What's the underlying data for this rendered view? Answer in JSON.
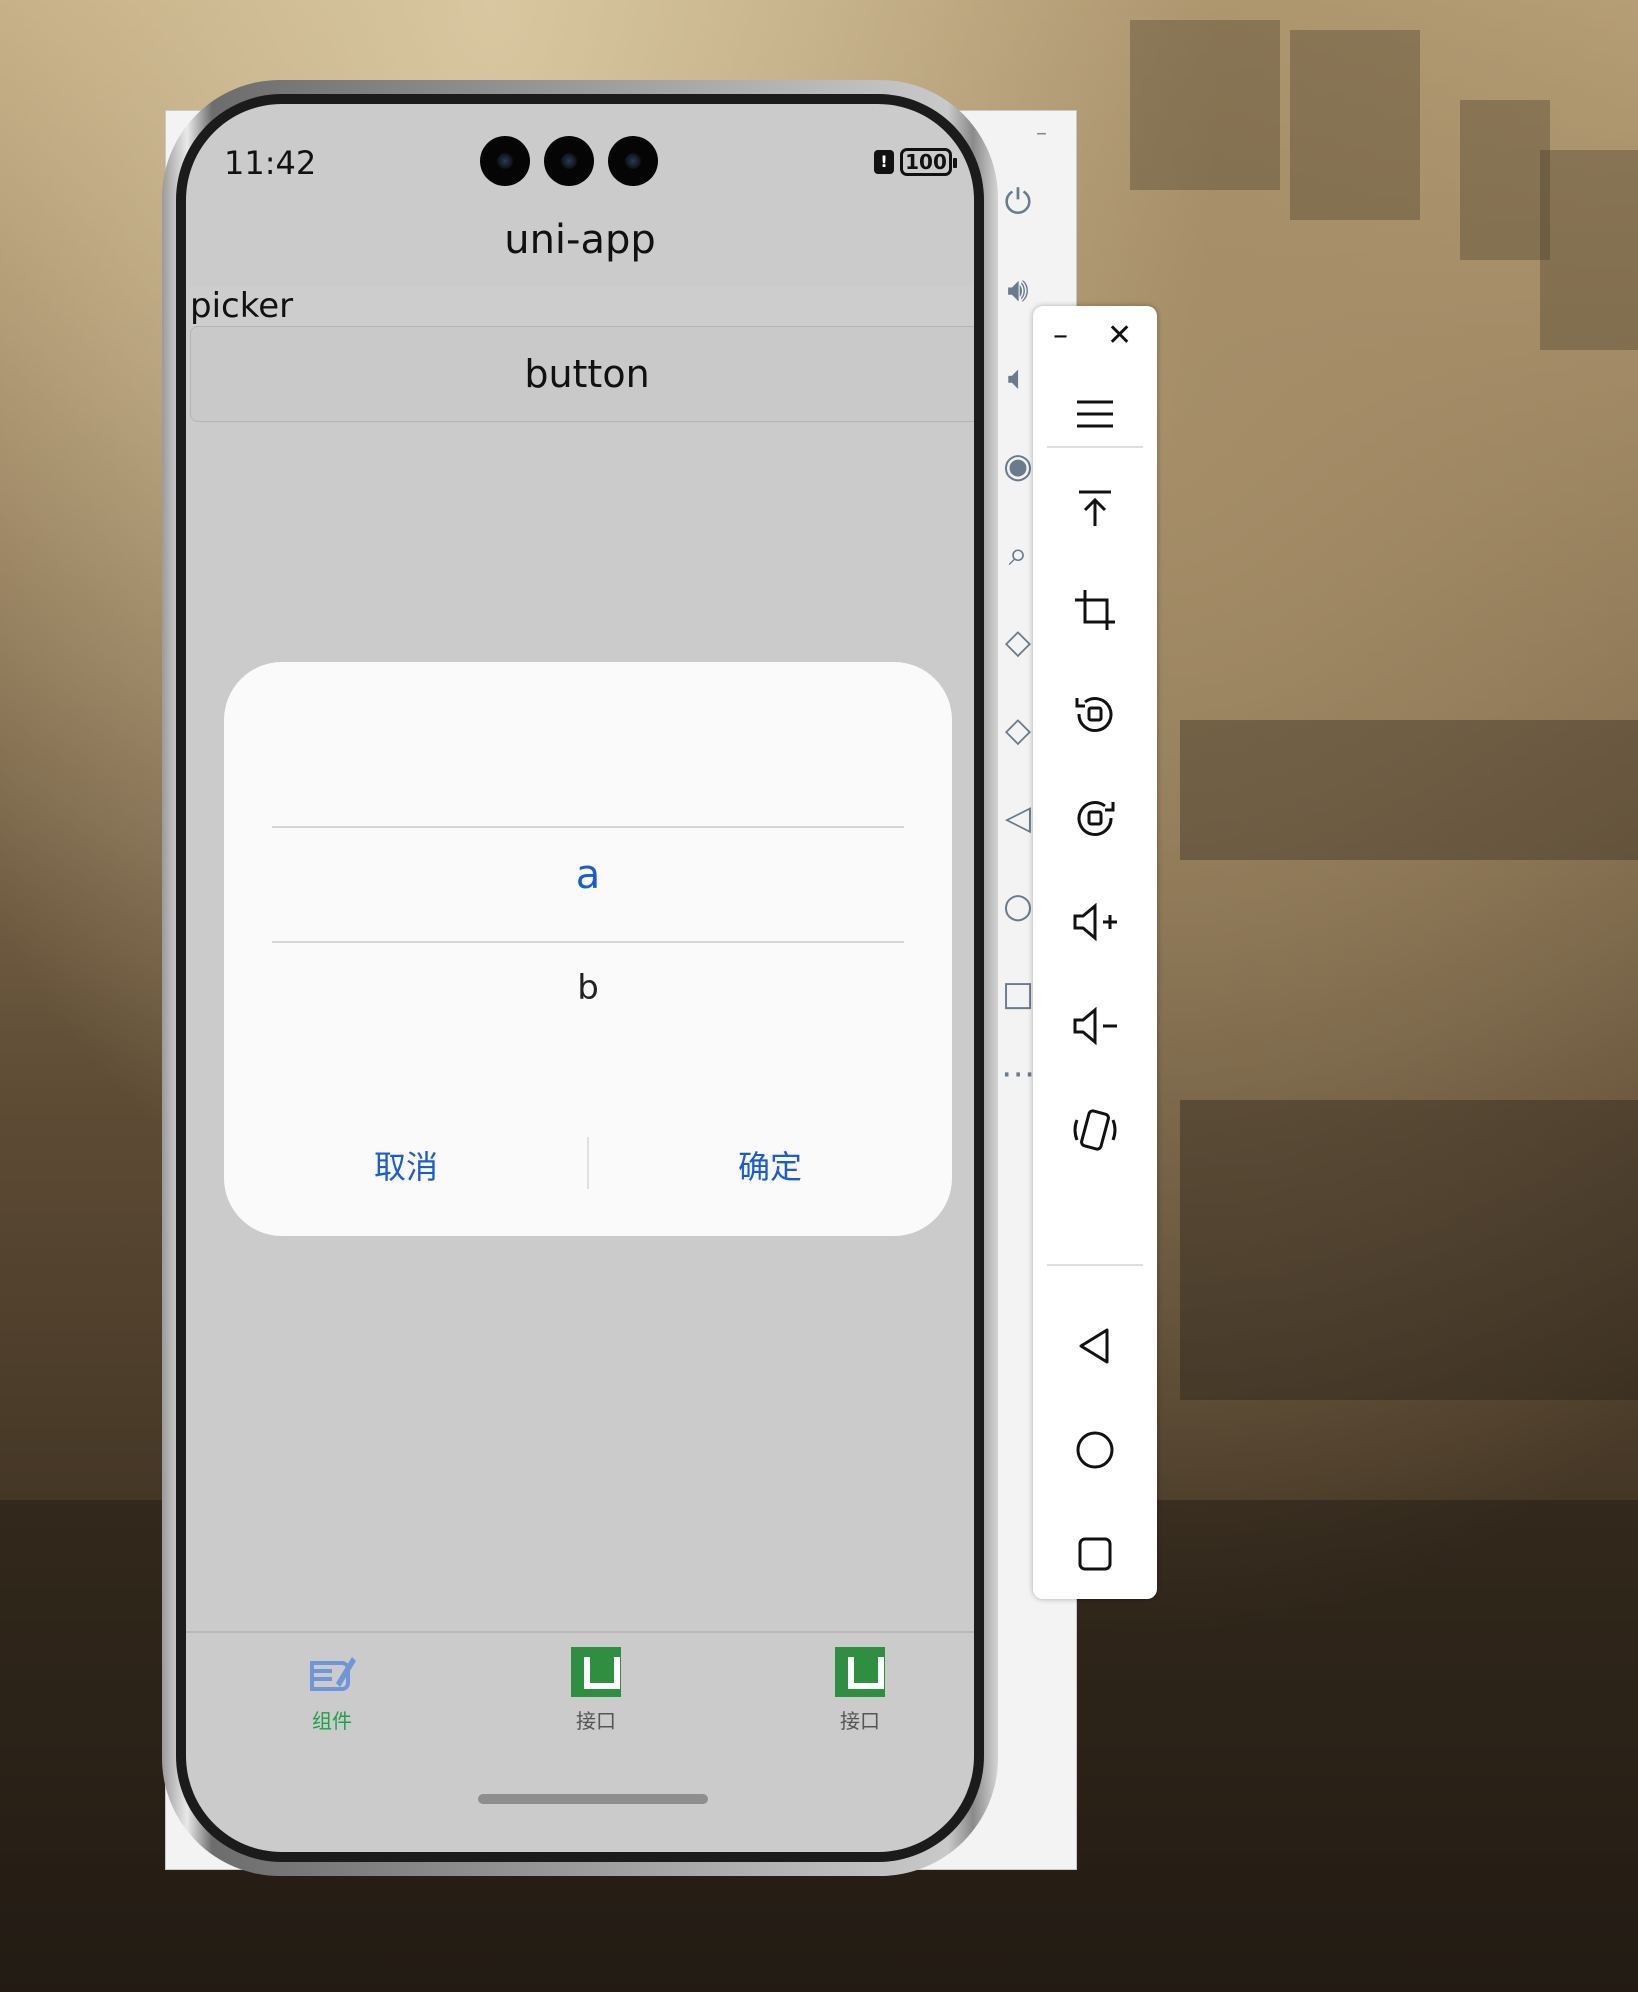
{
  "status_bar": {
    "time": "11:42",
    "battery": "100",
    "alert": "!"
  },
  "app": {
    "nav_title": "uni-app",
    "picker_label": "picker",
    "button_label": "button"
  },
  "picker_dialog": {
    "options": [
      "a",
      "b"
    ],
    "selected": "a",
    "cancel": "取消",
    "confirm": "确定"
  },
  "tabbar": {
    "items": [
      {
        "label": "组件",
        "icon": "components-icon",
        "active": true
      },
      {
        "label": "接口",
        "icon": "u-logo-icon",
        "active": false
      },
      {
        "label": "接口",
        "icon": "u-logo-icon",
        "active": false
      }
    ]
  },
  "back_window": {
    "minimize": "–"
  },
  "toolbar": {
    "minimize": "–",
    "close": "✕",
    "buttons": [
      "menu-icon",
      "pin-to-top-icon",
      "crop-icon",
      "rotate-left-icon",
      "rotate-right-icon",
      "volume-up-icon",
      "volume-down-icon",
      "shake-icon",
      "back-icon",
      "home-icon",
      "recents-icon"
    ]
  },
  "colors": {
    "accent": "#1a5cd6",
    "tab_active": "#1aa34a",
    "u_logo": "#2d8f3f"
  }
}
